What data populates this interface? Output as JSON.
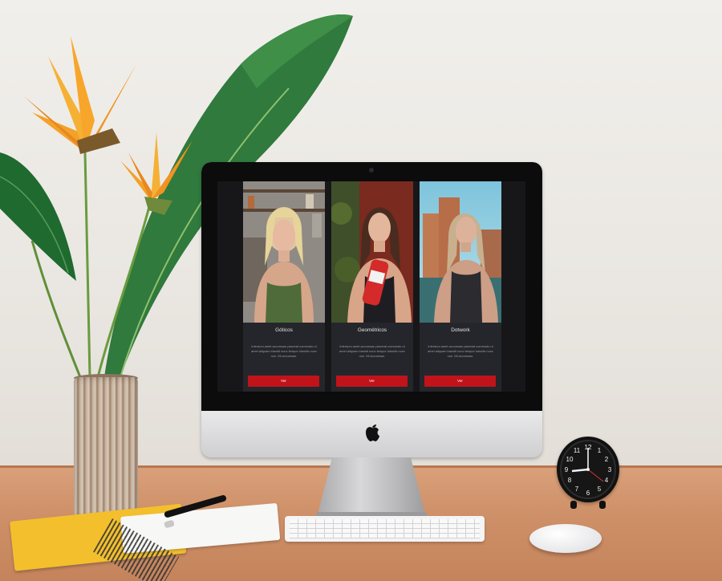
{
  "scene": {
    "description_colors": {
      "wall": "#ece9e4",
      "desk": "#d19670",
      "screen_bg": "#17171a",
      "card_bg": "#25262b",
      "button": "#c1131a",
      "notebook": "#f3bf2d"
    },
    "objects": [
      "plant-icon",
      "vase",
      "imac",
      "keyboard",
      "mouse",
      "notebook",
      "pen",
      "clock-icon"
    ]
  },
  "website": {
    "cards": [
      {
        "title": "Góticos",
        "text": "Interdum amet accumsan placerat commodo ut amet aliquam blandit nunc tempor lobortis nunc non. Mi accumsan.",
        "button": "Ver"
      },
      {
        "title": "Geométricos",
        "text": "Interdum amet accumsan placerat commodo ut amet aliquam blandit nunc tempor lobortis nunc non. Mi accumsan.",
        "button": "Ver"
      },
      {
        "title": "Dotwork",
        "text": "Interdum amet accumsan placerat commodo ut amet aliquam blandit nunc tempor lobortis nunc non. Mi accumsan.",
        "button": "Ver"
      }
    ]
  },
  "clock": {
    "numbers": [
      "12",
      "1",
      "2",
      "3",
      "4",
      "5",
      "6",
      "7",
      "8",
      "9",
      "10",
      "11"
    ]
  }
}
